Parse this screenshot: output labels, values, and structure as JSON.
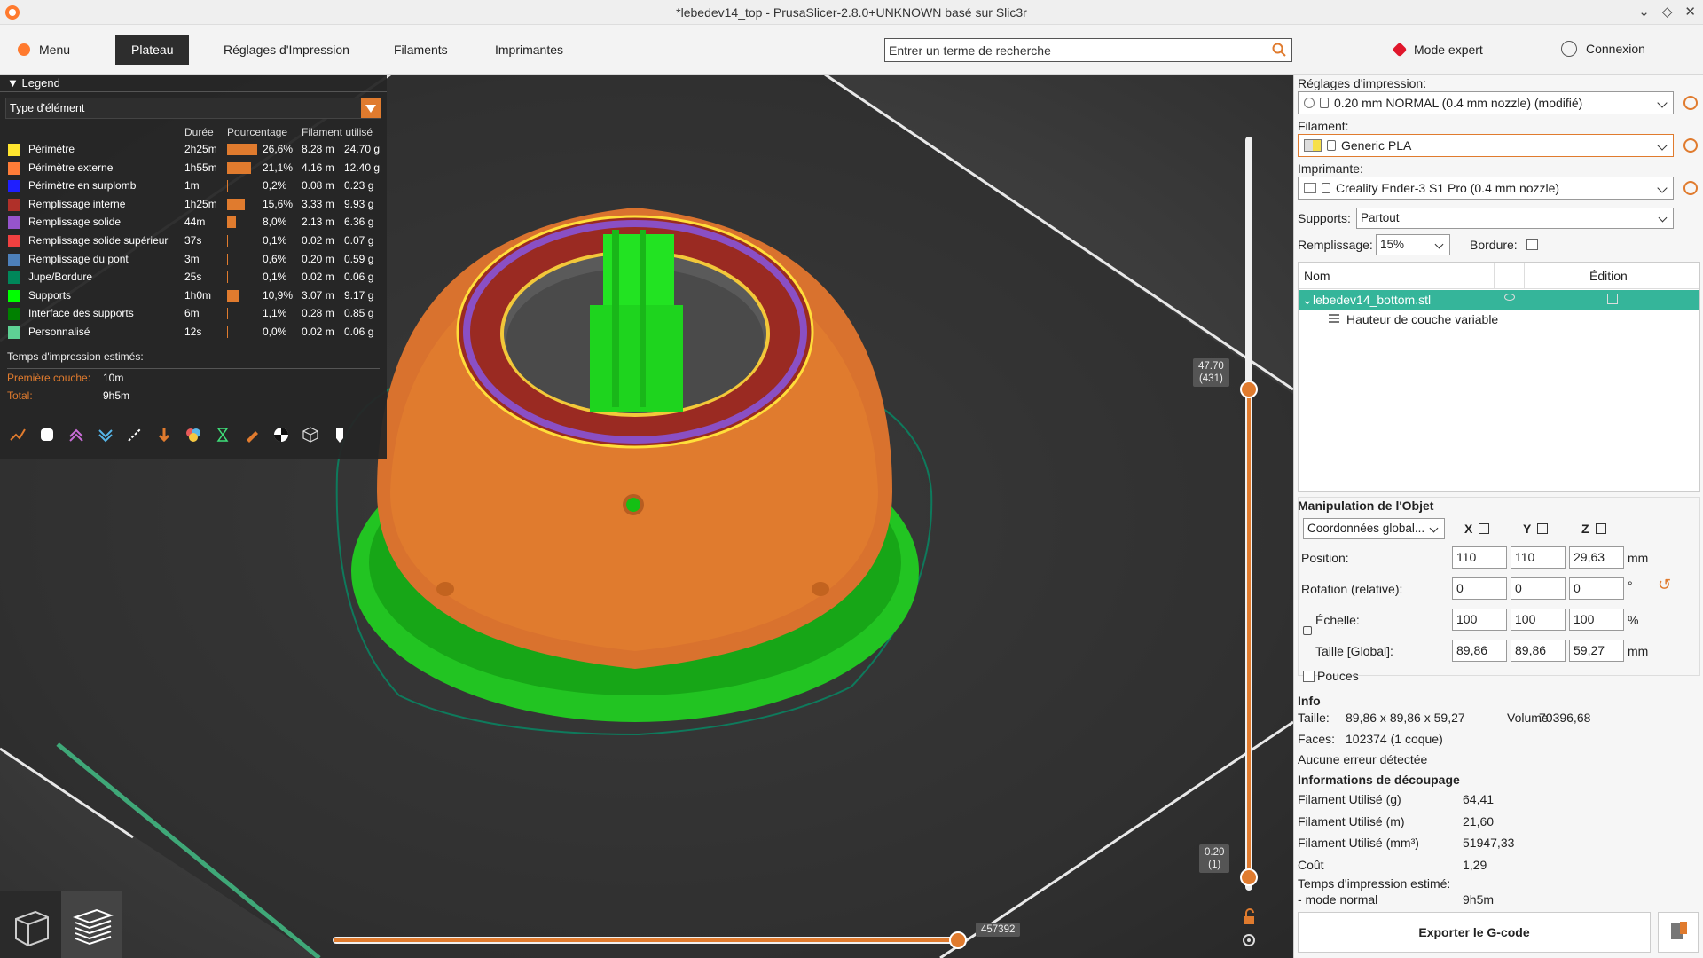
{
  "window": {
    "title": "*lebedev14_top - PrusaSlicer-2.8.0+UNKNOWN basé sur Slic3r"
  },
  "tabs": {
    "menu": "Menu",
    "items": [
      "Plateau",
      "Réglages d'Impression",
      "Filaments",
      "Imprimantes"
    ],
    "active": "Plateau"
  },
  "search": {
    "placeholder": "Entrer un terme de recherche"
  },
  "mode": {
    "label": "Mode expert",
    "color": "#e0162b"
  },
  "account": {
    "label": "Connexion"
  },
  "legend": {
    "title": "Legend",
    "view_type": "Type d'élément",
    "headers": {
      "duration": "Durée",
      "percent": "Pourcentage",
      "filament": "Filament utilisé"
    },
    "rows": [
      {
        "name": "Périmètre",
        "color": "#ffe52e",
        "duration": "2h25m",
        "pct": "26,6%",
        "pct_value": 26.6,
        "m": "8.28 m",
        "g": "24.70 g"
      },
      {
        "name": "Périmètre externe",
        "color": "#ff7d38",
        "duration": "1h55m",
        "pct": "21,1%",
        "pct_value": 21.1,
        "m": "4.16 m",
        "g": "12.40 g"
      },
      {
        "name": "Périmètre en surplomb",
        "color": "#1f1fff",
        "duration": "1m",
        "pct": "0,2%",
        "pct_value": 0.2,
        "m": "0.08 m",
        "g": "0.23 g"
      },
      {
        "name": "Remplissage interne",
        "color": "#b03029",
        "duration": "1h25m",
        "pct": "15,6%",
        "pct_value": 15.6,
        "m": "3.33 m",
        "g": "9.93 g"
      },
      {
        "name": "Remplissage solide",
        "color": "#9654cc",
        "duration": "44m",
        "pct": "8,0%",
        "pct_value": 8.0,
        "m": "2.13 m",
        "g": "6.36 g"
      },
      {
        "name": "Remplissage solide supérieur",
        "color": "#f04040",
        "duration": "37s",
        "pct": "0,1%",
        "pct_value": 0.1,
        "m": "0.02 m",
        "g": "0.07 g"
      },
      {
        "name": "Remplissage du pont",
        "color": "#4d80ba",
        "duration": "3m",
        "pct": "0,6%",
        "pct_value": 0.6,
        "m": "0.20 m",
        "g": "0.59 g"
      },
      {
        "name": "Jupe/Bordure",
        "color": "#00875a",
        "duration": "25s",
        "pct": "0,1%",
        "pct_value": 0.1,
        "m": "0.02 m",
        "g": "0.06 g"
      },
      {
        "name": "Supports",
        "color": "#00ff00",
        "duration": "1h0m",
        "pct": "10,9%",
        "pct_value": 10.9,
        "m": "3.07 m",
        "g": "9.17 g"
      },
      {
        "name": "Interface des supports",
        "color": "#008000",
        "duration": "6m",
        "pct": "1,1%",
        "pct_value": 1.1,
        "m": "0.28 m",
        "g": "0.85 g"
      },
      {
        "name": "Personnalisé",
        "color": "#5ed194",
        "duration": "12s",
        "pct": "0,0%",
        "pct_value": 0.0,
        "m": "0.02 m",
        "g": "0.06 g"
      }
    ],
    "times_title": "Temps d'impression estimés:",
    "first_layer_label": "Première couche:",
    "first_layer_value": "10m",
    "total_label": "Total:",
    "total_value": "9h5m",
    "accent": "#e07b2e"
  },
  "sliders": {
    "vertical_top": "47.70\n(431)",
    "vertical_top_a": "47.70",
    "vertical_top_b": "(431)",
    "vertical_bottom_a": "0.20",
    "vertical_bottom_b": "(1)",
    "horizontal_value": "457392"
  },
  "panel": {
    "print_settings_label": "Réglages d'impression:",
    "print_profile": "0.20 mm NORMAL (0.4 mm nozzle) (modifié)",
    "filament_label": "Filament:",
    "filament_profile": "Generic PLA",
    "printer_label": "Imprimante:",
    "printer_profile": "Creality Ender-3 S1 Pro (0.4 mm nozzle)",
    "supports_label": "Supports:",
    "supports_value": "Partout",
    "infill_label": "Remplissage:",
    "infill_value": "15%",
    "brim_label": "Bordure:",
    "objlist": {
      "col_name": "Nom",
      "col_edit": "Édition",
      "object": "lebedev14_bottom.stl",
      "child": "Hauteur de couche variable",
      "selected_color": "#35b59a"
    },
    "manip": {
      "title": "Manipulation de l'Objet",
      "coords": "Coordonnées global...",
      "x": "X",
      "y": "Y",
      "z": "Z",
      "position_label": "Position:",
      "position": [
        "110",
        "110",
        "29,63"
      ],
      "position_unit": "mm",
      "rotation_label": "Rotation (relative):",
      "rotation": [
        "0",
        "0",
        "0"
      ],
      "rotation_unit": "°",
      "scale_label": "Échelle:",
      "scale": [
        "100",
        "100",
        "100"
      ],
      "scale_unit": "%",
      "size_label": "Taille [Global]:",
      "size": [
        "89,86",
        "89,86",
        "59,27"
      ],
      "size_unit": "mm",
      "inches_label": "Pouces"
    },
    "info": {
      "title": "Info",
      "size_label": "Taille:",
      "size_value": "89,86 x 89,86 x 59,27",
      "volume_label": "Volume:",
      "volume_value": "70396,68",
      "faces_label": "Faces:",
      "faces_value": "102374 (1 coque)",
      "errors": "Aucune erreur détectée"
    },
    "slice": {
      "title": "Informations de découpage",
      "rows": [
        {
          "k": "Filament Utilisé (g)",
          "v": "64,41"
        },
        {
          "k": "Filament Utilisé (m)",
          "v": "21,60"
        },
        {
          "k": "Filament Utilisé (mm³)",
          "v": "51947,33"
        },
        {
          "k": "Coût",
          "v": "1,29"
        }
      ],
      "time_title": "Temps d'impression estimé:",
      "mode_label": "- mode normal",
      "mode_value": "9h5m"
    },
    "export_label": "Exporter le G-code"
  }
}
